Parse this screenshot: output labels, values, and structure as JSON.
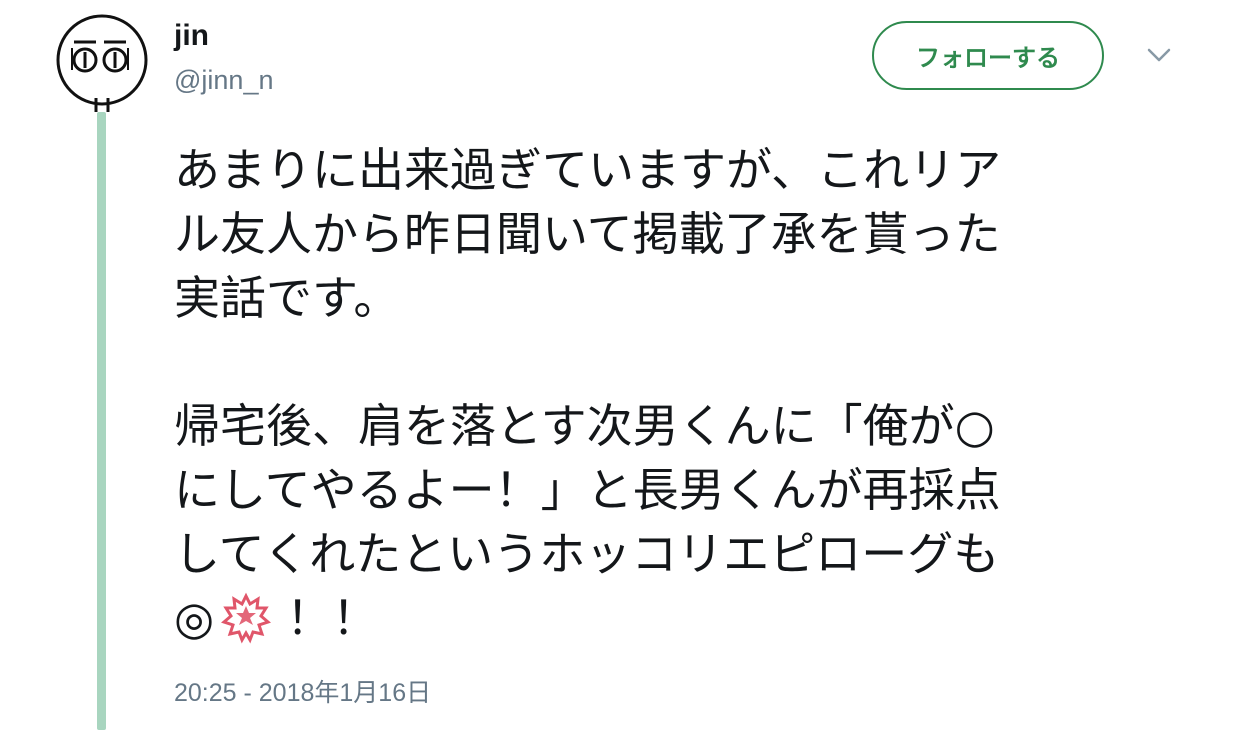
{
  "user": {
    "display_name": "jin",
    "handle": "@jinn_n"
  },
  "follow_button": {
    "label": "フォローする"
  },
  "tweet": {
    "lines": [
      "あまりに出来過ぎていますが、これリア",
      "ル友人から昨日聞いて掲載了承を貰った",
      "実話です。",
      "",
      "帰宅後、肩を落とす次男くんに「俺が○",
      "にしてやるよー！」と長男くんが再採点",
      "してくれたというホッコリエピローグも"
    ],
    "last_line": {
      "double_circle": "◎",
      "after_emoji": "！！"
    },
    "timestamp": "20:25 - 2018年1月16日"
  },
  "icons": {
    "avatar": "avatar-drawing",
    "caret": "chevron-down-icon",
    "emoji": "cherry-blossom-stamp-icon"
  },
  "colors": {
    "follow_green": "#2f8a4e",
    "thread_line": "#a8d5bf",
    "secondary_text": "#657786",
    "emoji_red": "#e0566a"
  }
}
